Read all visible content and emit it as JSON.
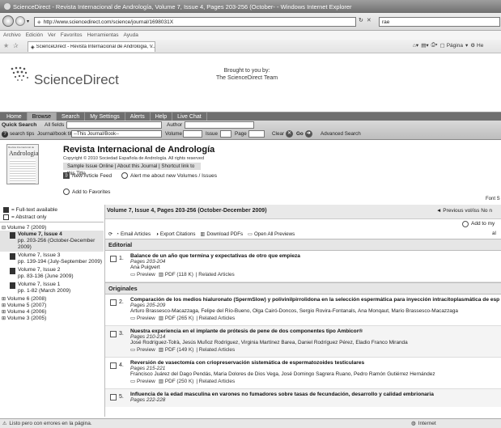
{
  "window": {
    "title": "ScienceDirect - Revista Internacional de Andrología, Volume 7, Issue 4, Pages 203-256 (October- - Windows Internet Explorer"
  },
  "addressbar": {
    "url": "http://www.sciencedirect.com/science/journal/1698031X",
    "search_value": "rae"
  },
  "menu": {
    "items": [
      "Archivo",
      "Edición",
      "Ver",
      "Favoritos",
      "Herramientas",
      "Ayuda"
    ]
  },
  "tab": {
    "title": "ScienceDirect - Revista Internacional de Andrologia, V...",
    "pagina": "Página",
    "he": "He"
  },
  "header": {
    "brand": "ScienceDirect",
    "brought_line1": "Brought to you by:",
    "brought_line2": "The ScienceDirect Team"
  },
  "nav": {
    "items": [
      "Home",
      "Browse",
      "Search",
      "My Settings",
      "Alerts",
      "Help",
      "Live Chat"
    ]
  },
  "quicksearch": {
    "title": "Quick Search",
    "all_fields": "All fields",
    "author": "Author",
    "search_tips": "search tips",
    "journal_title_label": "Journal/book title",
    "journal_title_value": "--This Journal/Book--",
    "volume": "Volume",
    "issue": "Issue",
    "page": "Page",
    "clear": "Clear",
    "go": "Go",
    "advanced": "Advanced Search"
  },
  "journal": {
    "cover_text": "Andrologia",
    "cover_top": "Revista Internacional de",
    "name": "Revista Internacional de Andrología",
    "copyright": "Copyright © 2010 Sociedad Española de Andrología. All rights reserved",
    "links": "Sample Issue Online | About this Journal | Shortcut link to this Title",
    "feed": "New Article Feed",
    "alert": "Alert me about new Volumes / Issues",
    "favorites": "Add to Favorites",
    "font_size": "Font S"
  },
  "sidebar": {
    "legend_full": "= Full-text available",
    "legend_abstract": "= Abstract only",
    "volume7": "Volume 7 (2009)",
    "issues": [
      {
        "title": "Volume 7, Issue 4",
        "pages": "pp. 203-256 (October-December 2009)",
        "selected": true
      },
      {
        "title": "Volume 7, Issue 3",
        "pages": "pp. 139-194 (July-September 2009)",
        "selected": false
      },
      {
        "title": "Volume 7, Issue 2",
        "pages": "pp. 83-136 (June 2009)",
        "selected": false
      },
      {
        "title": "Volume 7, Issue 1",
        "pages": "pp. 1-82 (March 2009)",
        "selected": false
      }
    ],
    "others": [
      "Volume 6 (2008)",
      "Volume 5 (2007)",
      "Volume 4 (2006)",
      "Volume 3 (2005)"
    ]
  },
  "content": {
    "issue_title": "Volume 7, Issue 4, Pages 203-256 (October-December 2009)",
    "prev_next": "◄ Previous vol/iss   No n",
    "add_to_my": "Add to my",
    "toolbar": [
      "Email Articles",
      "Export Citations",
      "Download PDFs",
      "Open All Previews"
    ],
    "toolbar_right": "al",
    "sections": [
      {
        "name": "Editorial",
        "articles": [
          {
            "num": "1.",
            "title": "Balance de un año que termina y expectativas de otro que empieza",
            "pages": "Pages 203-204",
            "authors": "Ana Puigvert",
            "preview": "Preview",
            "pdf": "PDF (118 K)",
            "related": "| Related Articles"
          }
        ]
      },
      {
        "name": "Originales",
        "articles": [
          {
            "num": "2.",
            "title": "Comparación de los medios hialuronato (SpermSlow) y polivinilpirrolidona en la selección espermática para inyección intracitoplasmática de espermatozo",
            "pages": "Pages 205-209",
            "authors": "Arturo Brassesco-Macazzaga, Felipe del Río-Bueno, Olga Cairó-Doncos, Sergio Rovira-Fontanals, Ana Monqaut, Mario Brassesco-Macazzaga",
            "preview": "Preview",
            "pdf": "PDF (265 K)",
            "related": "| Related Articles"
          },
          {
            "num": "3.",
            "title": "Nuestra experiencia en el implante de prótesis de pene de dos componentes tipo Ambicor®",
            "pages": "Pages 210-214",
            "authors": "José Rodríguez-Tolrà, Jesús Muñoz Rodríguez, Virginia Martínez Barea, Daniel Rodríguez Pérez, Eladio Franco Miranda",
            "preview": "Preview",
            "pdf": "PDF (149 K)",
            "related": "| Related Articles"
          },
          {
            "num": "4.",
            "title": "Reversión de vasectomía con criopreservación sistemática de espermatozoides testiculares",
            "pages": "Pages 215-221",
            "authors": "Francisco Juárez del Dago Pendás, María Dolores de Dios Vega, José Domingo Sagrera Ruano, Pedro Ramón Gutiérrez Hernández",
            "preview": "Preview",
            "pdf": "PDF (250 K)",
            "related": "| Related Articles"
          },
          {
            "num": "5.",
            "title": "Influencia de la edad masculina en varones no fumadores sobre tasas de fecundación, desarrollo y calidad embrionaria",
            "pages": "Pages 222-228",
            "authors": "",
            "preview": "",
            "pdf": "",
            "related": ""
          }
        ]
      }
    ]
  },
  "status": {
    "left": "Listo pero con errores en la página.",
    "right": "Internet"
  }
}
